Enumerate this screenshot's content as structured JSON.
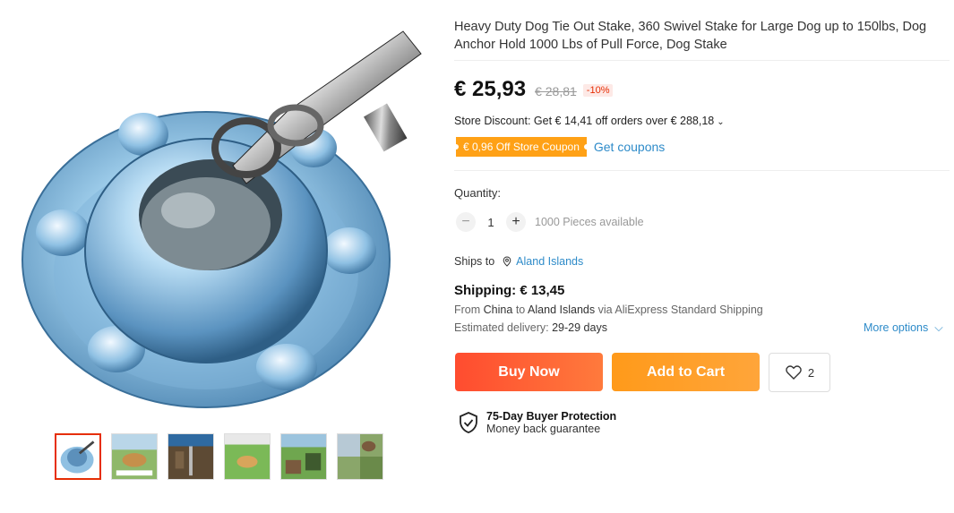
{
  "product": {
    "title": "Heavy Duty Dog Tie Out Stake, 360 Swivel Stake for Large Dog up to 150lbs, Dog Anchor Hold 1000 Lbs of Pull Force, Dog Stake",
    "price": "€ 25,93",
    "old_price": "€ 28,81",
    "discount": "-10%",
    "store_discount": "Store Discount: Get € 14,41 off orders over € 288,18",
    "coupon": "€ 0,96 Off Store Coupon",
    "get_coupons": "Get coupons"
  },
  "quantity": {
    "label": "Quantity:",
    "minus": "−",
    "value": "1",
    "plus": "+",
    "available": "1000 Pieces available"
  },
  "shipping": {
    "ships_to_label": "Ships to",
    "ships_to": "Aland Islands",
    "price_line": "Shipping: € 13,45",
    "from_prefix": "From",
    "from_country": "China",
    "to_word": "to",
    "to_country": "Aland Islands",
    "via": "via AliExpress Standard Shipping",
    "delivery_label": "Estimated delivery:",
    "delivery_days": "29-29 days",
    "more_options": "More options"
  },
  "actions": {
    "buy_now": "Buy Now",
    "add_to_cart": "Add to Cart",
    "wishlist_count": "2"
  },
  "protection": {
    "title": "75-Day Buyer Protection",
    "subtitle": "Money back guarantee"
  },
  "colors": {
    "accent_red": "#ff4c2f",
    "accent_orange": "#ffa116",
    "link_blue": "#2e8bc9"
  }
}
